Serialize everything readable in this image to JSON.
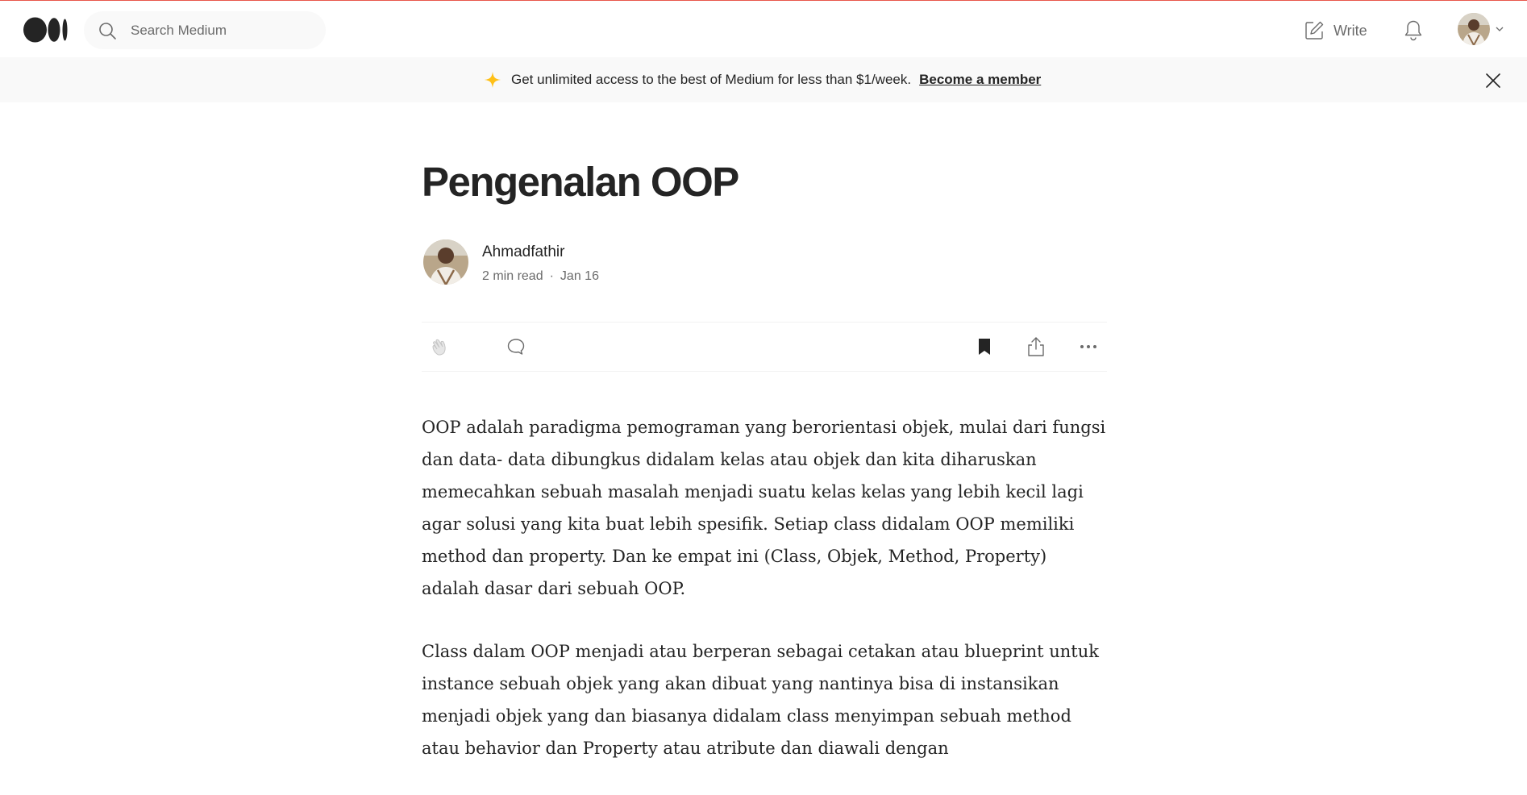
{
  "header": {
    "logo_name": "medium-logo",
    "search": {
      "placeholder": "Search Medium",
      "value": ""
    },
    "write_label": "Write",
    "icons": [
      "search-icon",
      "write-icon",
      "bell-icon",
      "chevron-down-icon"
    ]
  },
  "banner": {
    "text": "Get unlimited access to the best of Medium for less than $1/week.",
    "link": "Become a member",
    "sparkle_color": "#ffc017"
  },
  "article": {
    "title": "Pengenalan OOP",
    "author": "Ahmadfathir",
    "read_time": "2 min read",
    "separator": "·",
    "date": "Jan 16",
    "paragraphs": [
      "OOP adalah paradigma pemograman yang berorientasi objek, mulai dari fungsi dan data- data dibungkus didalam kelas atau objek dan kita diharuskan memecahkan sebuah masalah menjadi suatu kelas kelas yang lebih kecil lagi agar solusi yang kita buat lebih spesifik. Setiap class didalam OOP memiliki method dan property. Dan ke empat ini (Class, Objek, Method, Property) adalah dasar dari sebuah OOP.",
      "Class dalam OOP menjadi atau berperan sebagai cetakan atau blueprint untuk instance sebuah objek yang akan dibuat yang nantinya bisa di instansikan menjadi objek yang dan biasanya didalam class menyimpan sebuah method atau behavior dan Property atau atribute dan diawali dengan"
    ]
  },
  "actions": {
    "icons": [
      "clap-icon",
      "comment-icon",
      "bookmark-icon",
      "share-icon",
      "more-icon"
    ]
  },
  "colors": {
    "text": "#242424",
    "muted": "#6b6b6b",
    "banner_bg": "#f9f9f9",
    "top_border": "#e8574b"
  }
}
